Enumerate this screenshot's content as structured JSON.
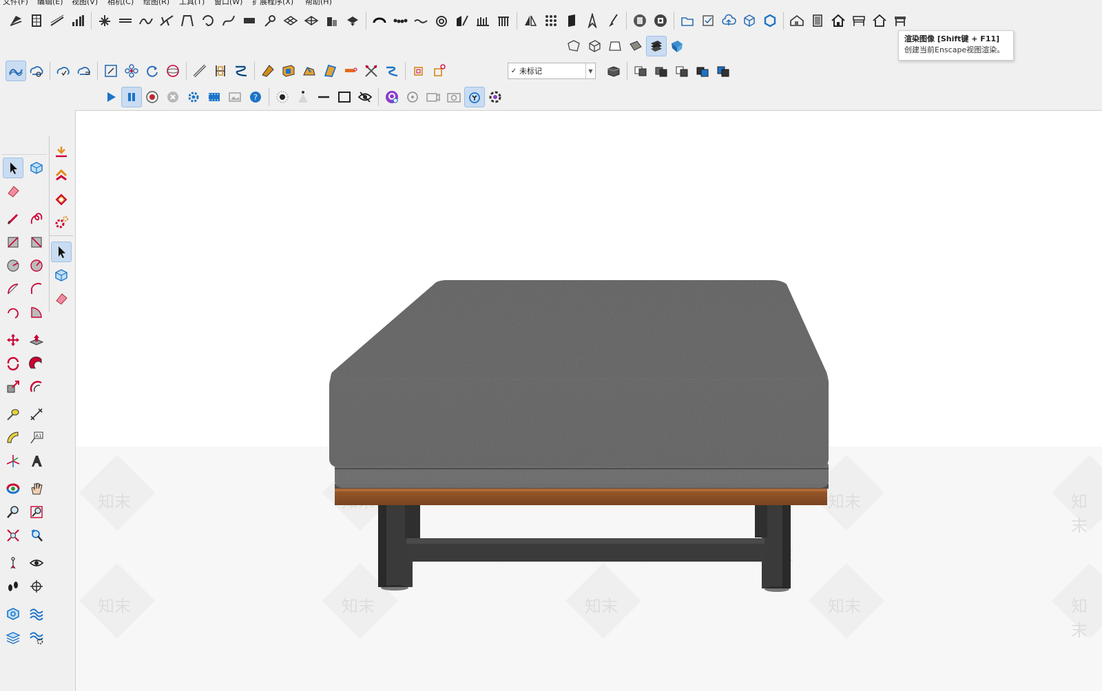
{
  "menu": {
    "items": [
      "文件(F)",
      "编辑(E)",
      "视图(V)",
      "相机(C)",
      "绘图(R)",
      "工具(T)",
      "窗口(W)",
      "扩展程序(X)",
      "帮助(H)"
    ]
  },
  "tag_selector": {
    "check": "✓",
    "value": "未标记"
  },
  "tooltip": {
    "title": "渲染图像 [Shift键 + F11]",
    "description": "创建当前Enscape视图渲染。"
  },
  "watermark": {
    "text": "知末"
  },
  "icons": {
    "toolbar_row1": [
      "sandbox-icon",
      "section-plane-icon",
      "line-curve-icon",
      "bar-chart-icon",
      "profile-builder-icon",
      "dimension-icon",
      "wave-icon",
      "branch-icon",
      "arch-icon",
      "loop-icon",
      "spline-icon",
      "flatten-icon",
      "pen-icon",
      "mesh-grid-icon",
      "lattice-icon",
      "buildings-icon",
      "hat-icon",
      "arc-icon",
      "dots-icon",
      "squiggle-icon",
      "spiral-icon",
      "split-icon",
      "columns-icon",
      "pillars-icon",
      "mirror-icon",
      "grid-dots-icon",
      "panel-icon",
      "compass-icon",
      "brush-icon",
      "enscape-launch-icon",
      "enscape-stop-icon",
      "folder-icon",
      "checklist-icon",
      "cloud-upload-icon",
      "package-icon",
      "sync-icon",
      "house-icon",
      "door-icon",
      "home-icon",
      "table-icon",
      "roof-icon",
      "stool-icon"
    ],
    "toolbar_row1b": [
      "xray-icon",
      "wireframe-icon",
      "hidden-line-icon",
      "shaded-icon",
      "shaded-texture-icon",
      "monochrome-icon"
    ],
    "toolbar_row2": [
      "sandbox-contour-icon",
      "sandbox-scratch-icon",
      "cloud-curve-icon",
      "cloud-flip-icon",
      "scale-box-icon",
      "flower-icon",
      "refresh-icon",
      "sphere-icon",
      "ruler-edge-icon",
      "bracket-icon",
      "extrude-icon",
      "wedge-icon",
      "box-icon",
      "cone-icon",
      "flag-icon",
      "mallet-icon",
      "scissors-icon",
      "curve-path-icon",
      "frame-icon",
      "move-frame-icon",
      "component-a-icon",
      "component-b-icon",
      "component-c-icon",
      "component-d-icon",
      "component-e-icon",
      "component-f-icon"
    ],
    "toolbar_row3": [
      "play-icon",
      "pause-icon",
      "record-icon",
      "stop-icon",
      "settings-gear-icon",
      "video-icon",
      "image-icon",
      "help-icon",
      "sun-icon",
      "light-cone-icon",
      "line-light-icon",
      "rect-light-icon",
      "hide-eye-icon",
      "panorama-icon",
      "orbit-icon",
      "camera-video-icon",
      "camera-icon",
      "timer-icon",
      "flower-settings-icon"
    ]
  }
}
